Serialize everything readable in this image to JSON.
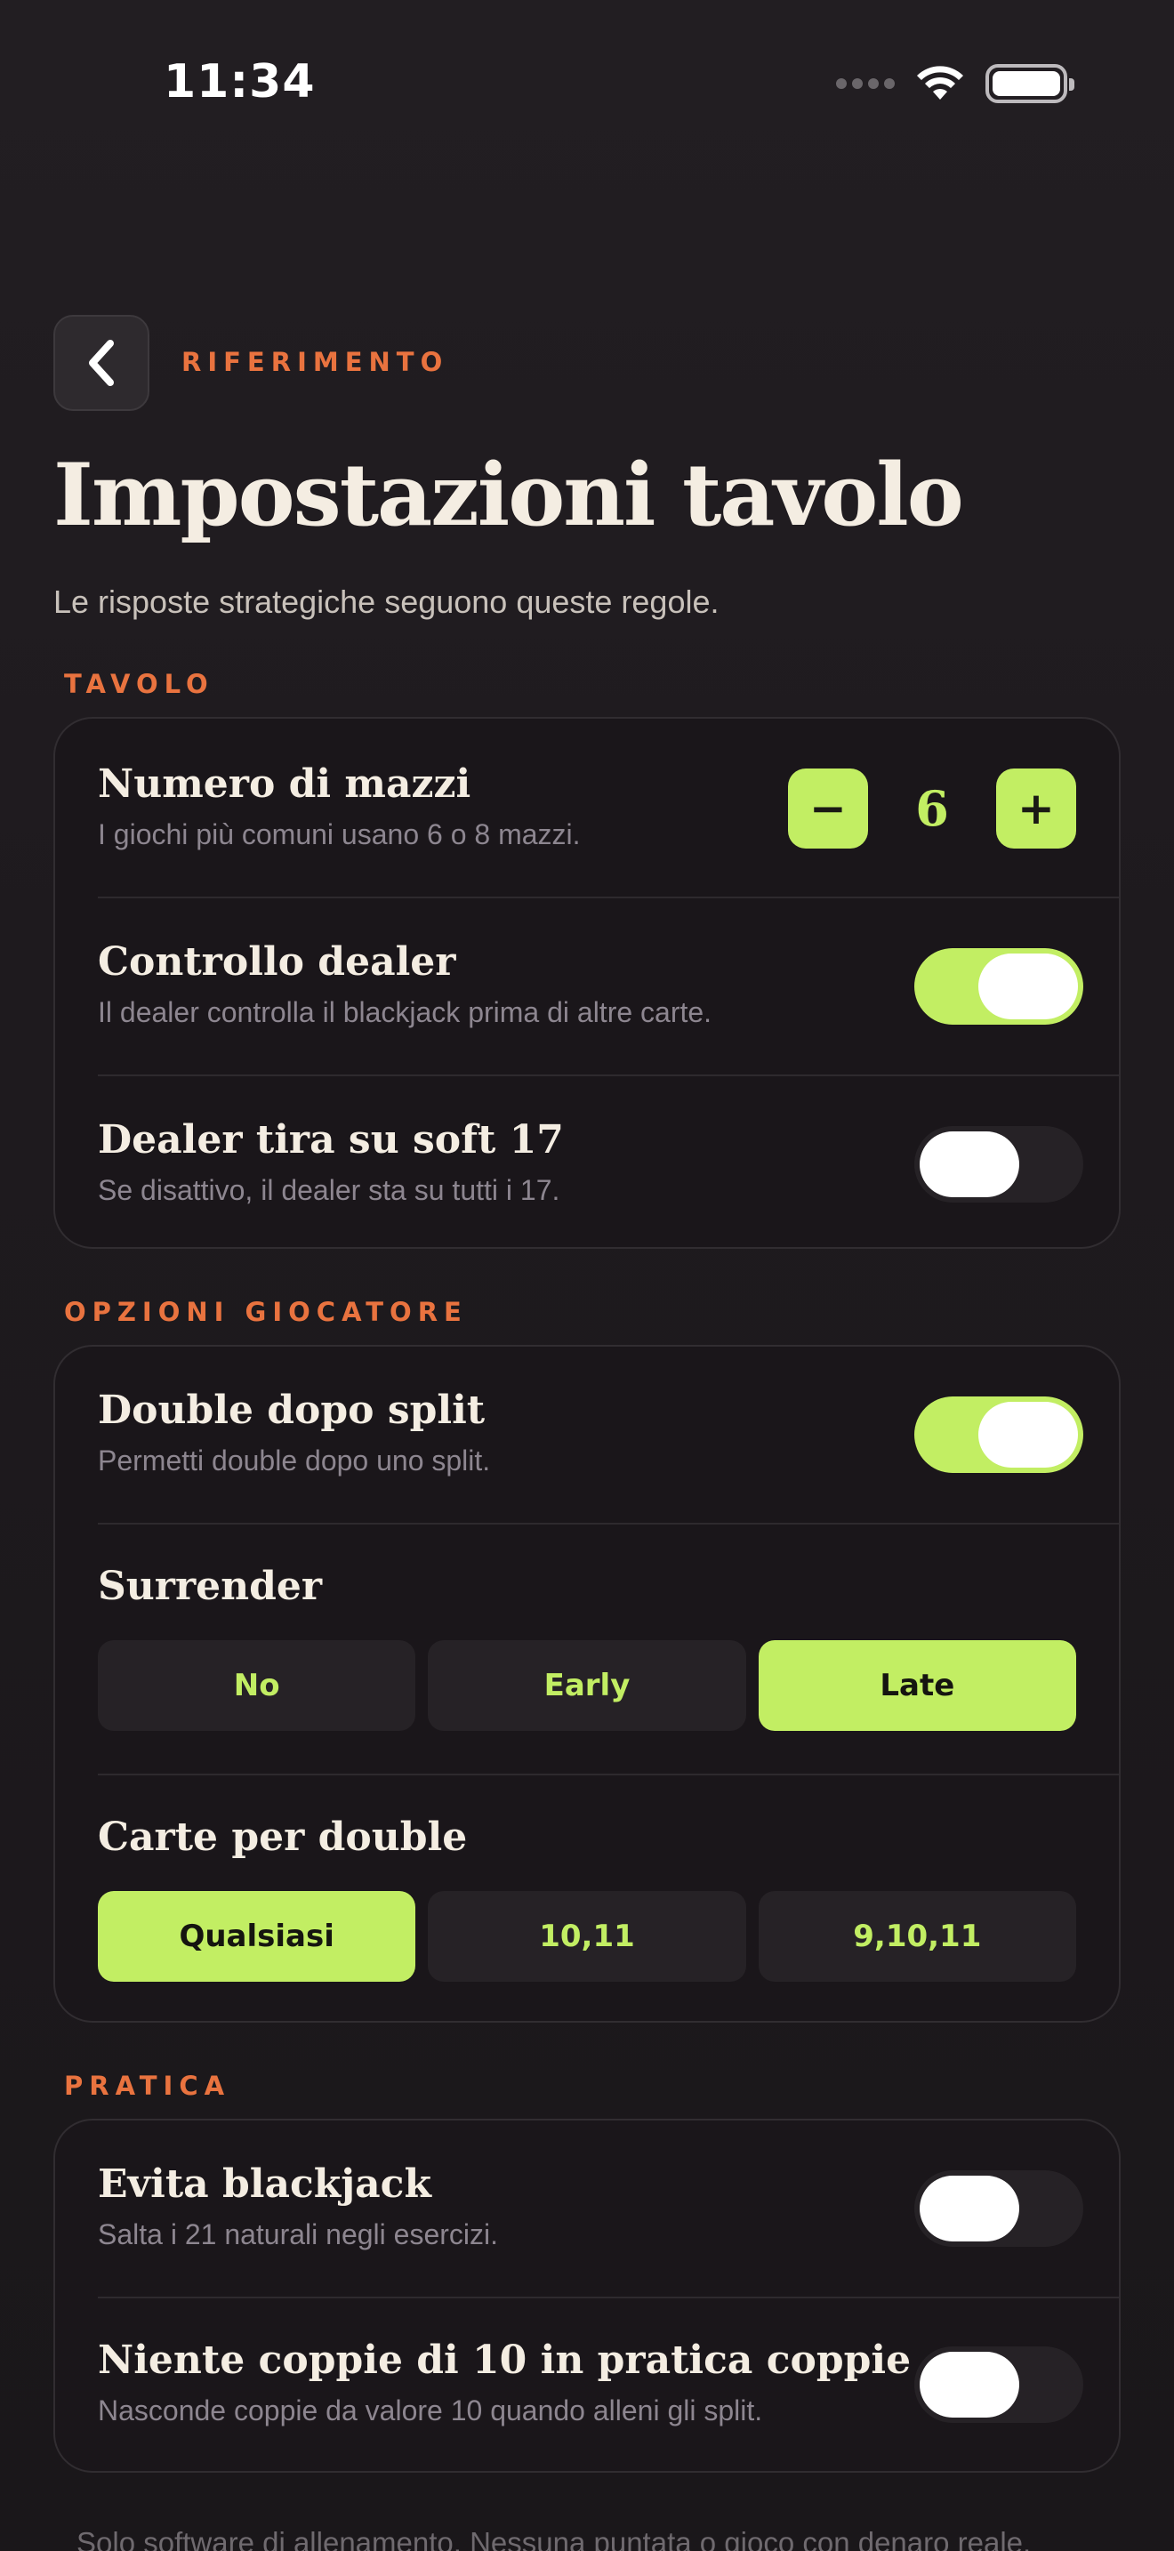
{
  "status_bar": {
    "time": "11:34"
  },
  "header": {
    "eyebrow": "RIFERIMENTO",
    "title": "Impostazioni tavolo",
    "subtitle": "Le risposte strategiche seguono queste regole."
  },
  "sections": {
    "table": {
      "label": "TAVOLO",
      "decks": {
        "title": "Numero di mazzi",
        "desc": "I giochi più comuni usano 6 o 8 mazzi.",
        "value": "6",
        "minus": "−",
        "plus": "+"
      },
      "dealer_peek": {
        "title": "Controllo dealer",
        "desc": "Il dealer controlla il blackjack prima di altre carte.",
        "on": true
      },
      "soft17": {
        "title": "Dealer tira su soft 17",
        "desc": "Se disattivo, il dealer sta su tutti i 17.",
        "on": false
      }
    },
    "player": {
      "label": "OPZIONI GIOCATORE",
      "das": {
        "title": "Double dopo split",
        "desc": "Permetti double dopo uno split.",
        "on": true
      },
      "surrender": {
        "title": "Surrender",
        "options": [
          "No",
          "Early",
          "Late"
        ],
        "selected": "Late"
      },
      "double_cards": {
        "title": "Carte per double",
        "options": [
          "Qualsiasi",
          "10,11",
          "9,10,11"
        ],
        "selected": "Qualsiasi"
      }
    },
    "practice": {
      "label": "PRATICA",
      "avoid_bj": {
        "title": "Evita blackjack",
        "desc": "Salta i 21 naturali negli esercizi.",
        "on": false
      },
      "no_tens": {
        "title": "Niente coppie di 10 in pratica coppie",
        "desc": "Nasconde coppie da valore 10 quando alleni gli split.",
        "on": false
      }
    }
  },
  "footer": "Solo software di allenamento. Nessuna puntata o gioco con denaro reale.",
  "colors": {
    "accent": "#c2ee63",
    "eyebrow": "#e9733f",
    "card": "#1a161a"
  }
}
